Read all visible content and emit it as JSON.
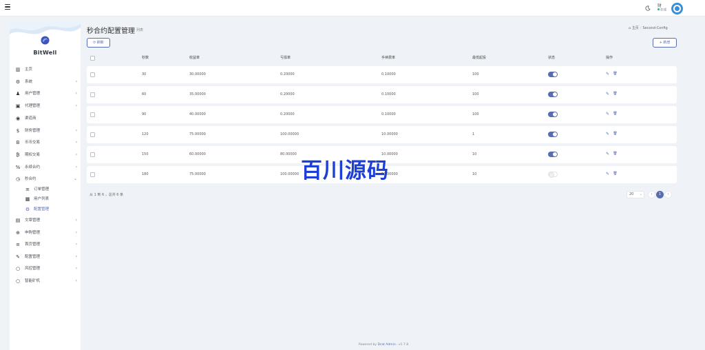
{
  "header": {
    "user_name": "财",
    "user_status": "在线"
  },
  "sidebar": {
    "brand": "BitWell",
    "items": [
      {
        "label": "主页",
        "icon": "bar-chart-icon",
        "chev": ""
      },
      {
        "label": "系统",
        "icon": "gear-icon",
        "chev": "‹"
      },
      {
        "label": "用户管理",
        "icon": "user-icon",
        "chev": "‹"
      },
      {
        "label": "代理管理",
        "icon": "id-card-icon",
        "chev": "‹"
      },
      {
        "label": "渠道商",
        "icon": "user-circle-icon",
        "chev": ""
      },
      {
        "label": "财务管理",
        "icon": "dollar-icon",
        "chev": "‹"
      },
      {
        "label": "币币交易",
        "icon": "bitcoin-icon",
        "chev": "‹"
      },
      {
        "label": "期权交易",
        "icon": "bitcoin-circle-icon",
        "chev": "‹"
      },
      {
        "label": "永续合约",
        "icon": "percent-icon",
        "chev": "‹"
      },
      {
        "label": "秒合约",
        "icon": "clock-icon",
        "chev": "⌄"
      }
    ],
    "sub_items": [
      {
        "label": "订单管理",
        "icon": "list-icon"
      },
      {
        "label": "用户列表",
        "icon": "user-box-icon"
      },
      {
        "label": "配置管理",
        "icon": "gear-icon"
      }
    ],
    "items_after": [
      {
        "label": "文章管理",
        "icon": "newspaper-icon",
        "chev": "‹"
      },
      {
        "label": "申购管理",
        "icon": "globe-icon",
        "chev": "‹"
      },
      {
        "label": "首页管理",
        "icon": "list-icon",
        "chev": "‹"
      },
      {
        "label": "配置管理",
        "icon": "wrench-icon",
        "chev": "‹"
      },
      {
        "label": "风控管理",
        "icon": "circle-icon",
        "chev": "‹"
      },
      {
        "label": "智能矿机",
        "icon": "circle-icon",
        "chev": "‹"
      }
    ]
  },
  "page": {
    "title": "秒合约配置管理",
    "subtitle": "列表",
    "breadcrumb_home": "主页",
    "breadcrumb_current": "Second-Config",
    "refresh_label": "刷新",
    "add_label": "+ 新增"
  },
  "table": {
    "headers": [
      "秒数",
      "收益率",
      "亏损率",
      "手续费率",
      "最低起投",
      "状态",
      "操作"
    ],
    "rows": [
      {
        "seconds": "30",
        "profit": "30.00000",
        "loss": "0.20000",
        "fee": "0.10000",
        "min": "100",
        "on": true
      },
      {
        "seconds": "60",
        "profit": "35.00000",
        "loss": "0.20000",
        "fee": "0.10000",
        "min": "100",
        "on": true
      },
      {
        "seconds": "90",
        "profit": "40.00000",
        "loss": "0.20000",
        "fee": "0.10000",
        "min": "100",
        "on": true
      },
      {
        "seconds": "120",
        "profit": "75.00000",
        "loss": "100.00000",
        "fee": "10.00000",
        "min": "1",
        "on": true
      },
      {
        "seconds": "150",
        "profit": "60.00000",
        "loss": "80.00000",
        "fee": "10.00000",
        "min": "10",
        "on": true
      },
      {
        "seconds": "180",
        "profit": "75.00000",
        "loss": "100.00000",
        "fee": "10.00000",
        "min": "10",
        "on": false
      }
    ]
  },
  "pagination": {
    "summary": "从 1 到 6 ，总共 6 条",
    "page_size": "20",
    "current_page": "1",
    "prev": "‹",
    "next": "›"
  },
  "footer": {
    "prefix": "Powered by",
    "brand": "Dcat Admin",
    "version": "· v1.7.8"
  },
  "watermark": "百川源码",
  "colors": {
    "accent": "#586cb1",
    "online": "#21b978",
    "avatar": "#3a8fd6"
  }
}
